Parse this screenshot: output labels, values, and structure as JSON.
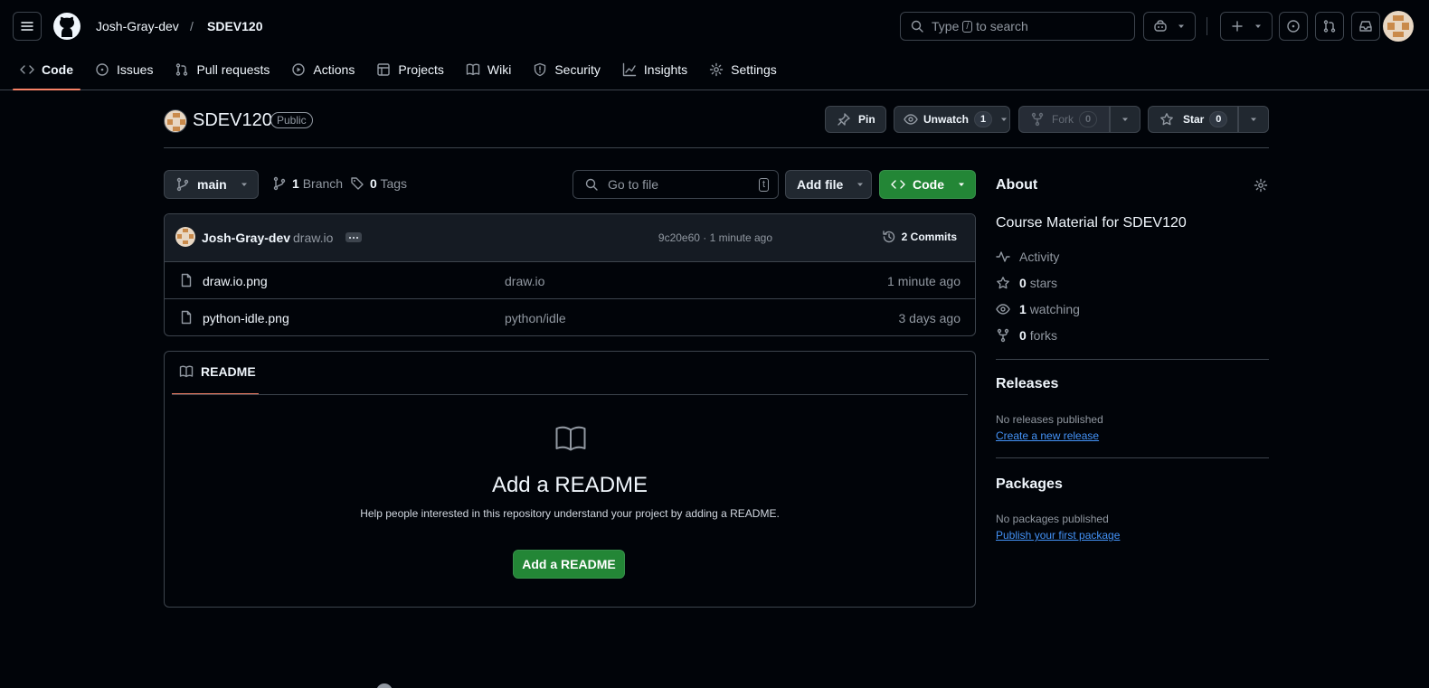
{
  "header": {
    "owner": "Josh-Gray-dev",
    "separator": "/",
    "repo": "SDEV120",
    "search_prefix": "Type",
    "search_key": "/",
    "search_suffix": "to search"
  },
  "tabs": [
    {
      "label": "Code",
      "icon": "code-icon",
      "active": true
    },
    {
      "label": "Issues",
      "icon": "issue-icon"
    },
    {
      "label": "Pull requests",
      "icon": "pull-request-icon"
    },
    {
      "label": "Actions",
      "icon": "play-icon"
    },
    {
      "label": "Projects",
      "icon": "table-icon"
    },
    {
      "label": "Wiki",
      "icon": "book-icon"
    },
    {
      "label": "Security",
      "icon": "shield-icon"
    },
    {
      "label": "Insights",
      "icon": "graph-icon"
    },
    {
      "label": "Settings",
      "icon": "gear-icon"
    }
  ],
  "repo": {
    "name": "SDEV120",
    "visibility": "Public",
    "pin_label": "Pin",
    "watch_label": "Unwatch",
    "watch_count": "1",
    "fork_label": "Fork",
    "fork_count": "0",
    "star_label": "Star",
    "star_count": "0"
  },
  "browser": {
    "branch": "main",
    "branch_count": "1",
    "branch_label": "Branch",
    "tag_count": "0",
    "tag_label": "Tags",
    "goto_placeholder": "Go to file",
    "goto_key": "t",
    "add_file_label": "Add file",
    "code_label": "Code"
  },
  "commit": {
    "author": "Josh-Gray-dev",
    "message": "draw.io",
    "sha_time": "9c20e60 · 1 minute ago",
    "commits_label": "2 Commits"
  },
  "files": [
    {
      "name": "draw.io.png",
      "message": "draw.io",
      "time": "1 minute ago"
    },
    {
      "name": "python-idle.png",
      "message": "python/idle",
      "time": "3 days ago"
    }
  ],
  "readme": {
    "tab_label": "README",
    "title": "Add a README",
    "description": "Help people interested in this repository understand your project by adding a README.",
    "button_label": "Add a README"
  },
  "about": {
    "heading": "About",
    "description": "Course Material for SDEV120",
    "activity_label": "Activity",
    "stars_count": "0",
    "stars_label": "stars",
    "watching_count": "1",
    "watching_label": "watching",
    "forks_count": "0",
    "forks_label": "forks"
  },
  "releases": {
    "heading": "Releases",
    "empty": "No releases published",
    "link": "Create a new release"
  },
  "packages": {
    "heading": "Packages",
    "empty": "No packages published",
    "link": "Publish your first package"
  },
  "colors": {
    "background": "#010409",
    "accent_green": "#238636",
    "tab_underline": "#f78166",
    "link_blue": "#4493f8"
  }
}
